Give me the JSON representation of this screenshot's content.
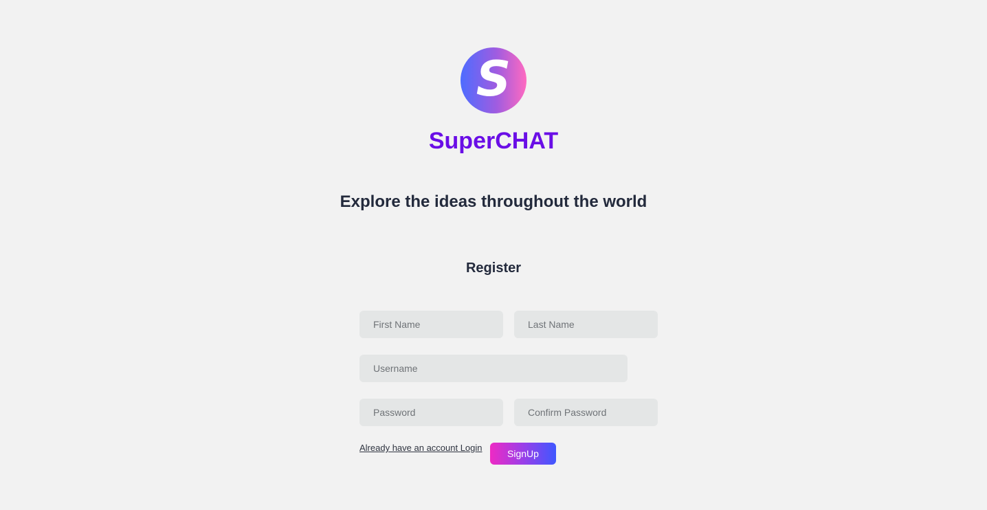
{
  "brand": {
    "logo_letter": "S",
    "name": "SuperCHAT",
    "logo_icon": "superchat-logo-icon",
    "brand_color": "#6a0ee6",
    "logo_gradient": [
      "#4d6cff",
      "#a05ce0",
      "#ff6ac0"
    ]
  },
  "tagline": "Explore the ideas throughout the world",
  "form": {
    "title": "Register",
    "fields": {
      "first_name": {
        "placeholder": "First Name",
        "value": ""
      },
      "last_name": {
        "placeholder": "Last Name",
        "value": ""
      },
      "username": {
        "placeholder": "Username",
        "value": ""
      },
      "password": {
        "placeholder": "Password",
        "value": ""
      },
      "confirm_password": {
        "placeholder": "Confirm Password",
        "value": ""
      }
    },
    "login_link": "Already have an account Login",
    "submit_label": "SignUp",
    "submit_gradient": [
      "#ee2ac4",
      "#9a3fe8",
      "#3f57ff"
    ]
  }
}
